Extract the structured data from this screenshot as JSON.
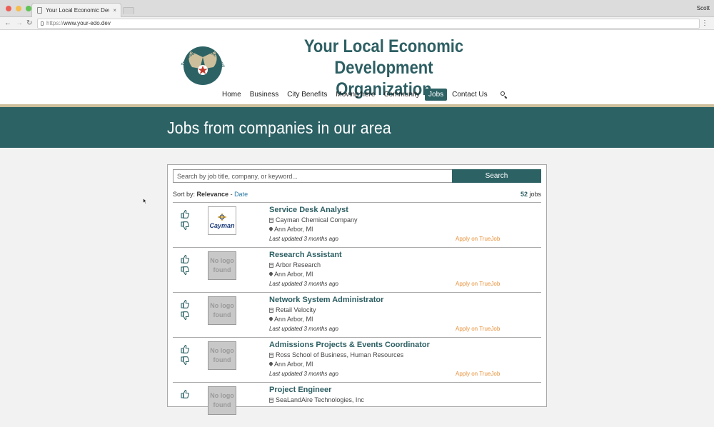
{
  "browser": {
    "tab_title": "Your Local Economic Development Organization",
    "tab_close": "×",
    "user": "Scott",
    "url_scheme": "https://",
    "url_host": "www.your-edo.dev",
    "back": "←",
    "forward": "→",
    "reload": "↻",
    "menu": "⋮"
  },
  "site": {
    "title_line1": "Your Local Economic",
    "title_line2": "Development Organization",
    "logo_text": "TrueJob Economic Development · Prosperity",
    "nav": [
      "Home",
      "Business",
      "City Benefits",
      "Moving here",
      "Community",
      "Jobs",
      "Contact Us"
    ],
    "nav_active": "Jobs"
  },
  "banner": {
    "heading": "Jobs from companies in our area"
  },
  "jobs_search": {
    "placeholder": "Search by job title, company, or keyword...",
    "button": "Search",
    "sort_prefix": "Sort by:",
    "sort_relevance": "Relevance",
    "sort_sep": " - ",
    "sort_date": "Date",
    "count": "52",
    "count_suffix": " jobs"
  },
  "jobs": [
    {
      "title": "Service Desk Analyst",
      "company": "Cayman Chemical Company",
      "location": "Ann Arbor, MI",
      "updated": "Last updated 3 months ago",
      "apply": "Apply on TrueJob",
      "logo": "Cayman"
    },
    {
      "title": "Research Assistant",
      "company": "Arbor Research",
      "location": "Ann Arbor, MI",
      "updated": "Last updated 3 months ago",
      "apply": "Apply on TrueJob",
      "logo": "No logo found"
    },
    {
      "title": "Network System Administrator",
      "company": "Retail Velocity",
      "location": "Ann Arbor, MI",
      "updated": "Last updated 3 months ago",
      "apply": "Apply on TrueJob",
      "logo": "No logo found"
    },
    {
      "title": "Admissions Projects & Events Coordinator",
      "company": "Ross School of Business, Human Resources",
      "location": "Ann Arbor, MI",
      "updated": "Last updated 3 months ago",
      "apply": "Apply on TrueJob",
      "logo": "No logo found"
    },
    {
      "title": "Project Engineer",
      "company": "SeaLandAire Technologies, Inc",
      "location": "",
      "updated": "",
      "apply": "",
      "logo": "No logo found"
    }
  ],
  "colors": {
    "brand_teal": "#2d6265",
    "accent_tan": "#cdbf9b",
    "apply_orange": "#e8913a",
    "link_blue": "#2a7aa5"
  }
}
